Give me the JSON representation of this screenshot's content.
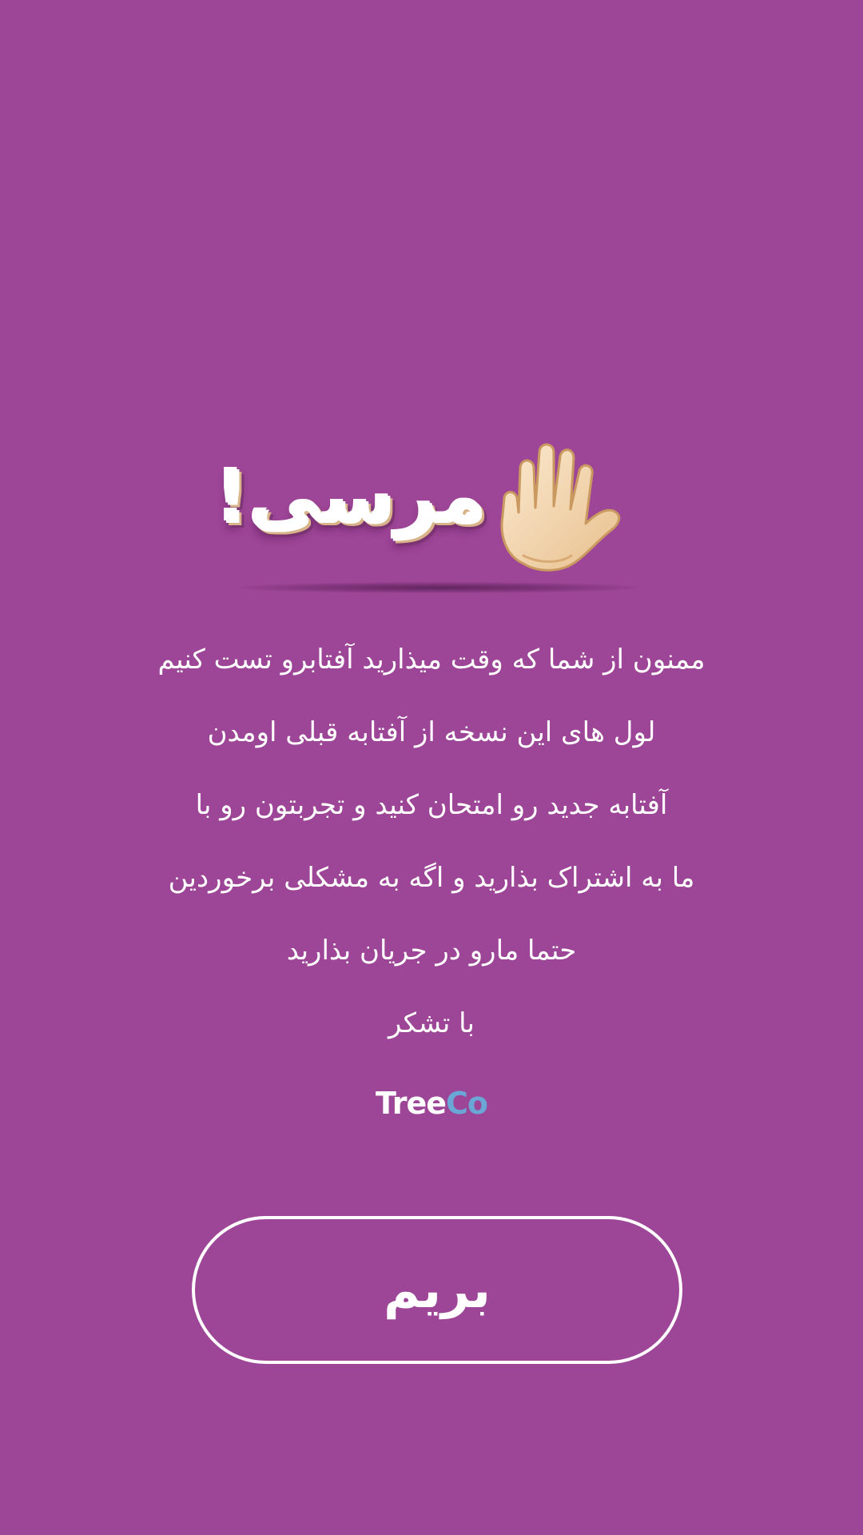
{
  "theme": {
    "background": "#9d4596",
    "text": "#ffffff",
    "brand_accent": "#6aa6d6",
    "hand_skin": "#f3d9b0"
  },
  "header": {
    "title": "مرسی!",
    "icon": "raised-hand-icon"
  },
  "message": {
    "lines": [
      "ممنون از شما که وقت میذارید آفتابرو تست کنیم",
      "لول های این نسخه از آفتابه قبلی اومدن",
      "آفتابه جدید رو امتحان کنید و تجربتون رو با",
      "ما به اشتراک بذارید و اگه به مشکلی برخوردین",
      "حتما مارو در جریان بذارید",
      "با تشکر"
    ]
  },
  "brand": {
    "part1": "Tree",
    "part2": "Co"
  },
  "button": {
    "label": "بریم"
  }
}
